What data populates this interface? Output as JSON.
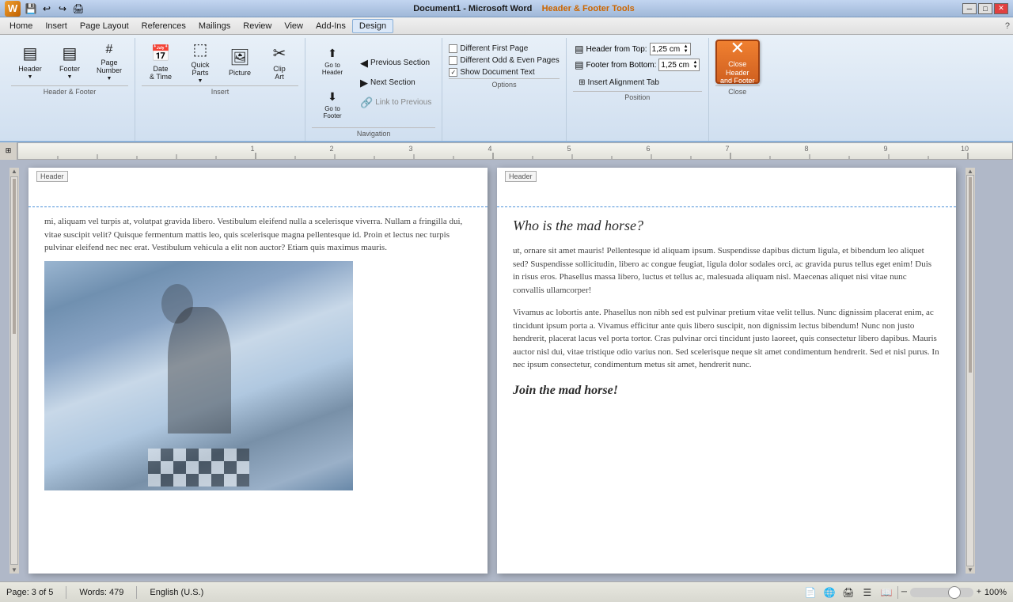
{
  "titlebar": {
    "title": "Document1 - Microsoft Word",
    "ribbon_title": "Header & Footer Tools"
  },
  "menubar": {
    "items": [
      "Home",
      "Insert",
      "Page Layout",
      "References",
      "Mailings",
      "Review",
      "View",
      "Add-Ins",
      "Design"
    ]
  },
  "ribbon": {
    "groups": [
      {
        "label": "Header & Footer",
        "buttons": [
          {
            "id": "header",
            "icon": "▤",
            "label": "Header"
          },
          {
            "id": "footer",
            "icon": "▤",
            "label": "Footer"
          },
          {
            "id": "page_number",
            "icon": "#",
            "label": "Page\nNumber"
          }
        ]
      },
      {
        "label": "Insert",
        "buttons": [
          {
            "id": "date_time",
            "icon": "📅",
            "label": "Date\n& Time"
          },
          {
            "id": "quick_parts",
            "icon": "⬚",
            "label": "Quick\nParts"
          },
          {
            "id": "picture",
            "icon": "🖼",
            "label": "Picture"
          },
          {
            "id": "clip_art",
            "icon": "✂",
            "label": "Clip\nArt"
          }
        ]
      },
      {
        "label": "Navigation",
        "small_buttons": [
          {
            "id": "goto_header",
            "icon": "⬆",
            "label": "Go to\nHeader"
          },
          {
            "id": "goto_footer",
            "icon": "⬇",
            "label": "Go to\nFooter"
          },
          {
            "id": "prev_section",
            "icon": "◀",
            "label": "Previous Section"
          },
          {
            "id": "next_section",
            "icon": "▶",
            "label": "Next Section"
          },
          {
            "id": "link_prev",
            "icon": "🔗",
            "label": "Link to Previous"
          }
        ]
      },
      {
        "label": "Options",
        "checkboxes": [
          {
            "id": "diff_first",
            "label": "Different First Page",
            "checked": false
          },
          {
            "id": "diff_odd_even",
            "label": "Different Odd & Even Pages",
            "checked": false
          },
          {
            "id": "show_doc_text",
            "label": "Show Document Text",
            "checked": true
          }
        ]
      },
      {
        "label": "Position",
        "inputs": [
          {
            "id": "header_top",
            "icon": "▤",
            "label": "Header from Top:",
            "value": "1,25 cm"
          },
          {
            "id": "footer_bottom",
            "icon": "▤",
            "label": "Footer from Bottom:",
            "value": "1,25 cm"
          },
          {
            "id": "insert_align",
            "icon": "⊞",
            "label": "Insert Alignment Tab"
          }
        ]
      },
      {
        "label": "Close",
        "buttons": [
          {
            "id": "close_hf",
            "icon": "✕",
            "label": "Close Header\nand Footer"
          }
        ]
      }
    ],
    "close_btn_label": "Close Header\nand Footer"
  },
  "left_page": {
    "header_label": "Header",
    "body_text": "mi, aliquam vel turpis at, volutpat gravida libero. Vestibulum eleifend nulla a scelerisque viverra. Nullam a fringilla dui, vitae suscipit velit? Quisque fermentum mattis leo, quis scelerisque magna pellentesque id. Proin et lectus nec turpis pulvinar eleifend nec nec erat. Vestibulum vehicula a elit non auctor? Etiam quis maximus mauris.",
    "has_image": true,
    "image_alt": "Chess game photo"
  },
  "right_page": {
    "header_label": "Header",
    "title": "Who is the mad horse?",
    "body_para1": "ut, ornare sit amet mauris! Pellentesque id aliquam ipsum. Suspendisse dapibus dictum ligula, et bibendum leo aliquet sed? Suspendisse sollicitudin, libero ac congue feugiat, ligula dolor sodales orci, ac gravida purus tellus eget enim! Duis in risus eros. Phasellus massa libero, luctus et tellus ac, malesuada aliquam nisl. Maecenas aliquet nisi vitae nunc convallis ullamcorper!",
    "body_para2": "Vivamus ac lobortis ante. Phasellus non nibh sed est pulvinar pretium vitae velit tellus. Nunc dignissim placerat enim, ac tincidunt ipsum porta a. Vivamus efficitur ante quis libero suscipit, non dignissim lectus bibendum! Nunc non justo hendrerit, placerat lacus vel porta tortor. Cras pulvinar orci tincidunt justo laoreet, quis consectetur libero dapibus. Mauris auctor nisl dui, vitae tristique odio varius non. Sed scelerisque neque sit amet condimentum hendrerit. Sed et nisl purus. In nec ipsum consectetur, condimentum metus sit amet, hendrerit nunc.",
    "subtitle": "Join the mad horse!"
  },
  "statusbar": {
    "page_info": "Page: 3 of 5",
    "words": "Words: 479",
    "language": "English (U.S.)",
    "zoom": "100%"
  },
  "icons": {
    "word_logo": "W",
    "minimize": "─",
    "maximize": "□",
    "close": "✕",
    "scroll_left": "◄",
    "scroll_right": "►"
  }
}
